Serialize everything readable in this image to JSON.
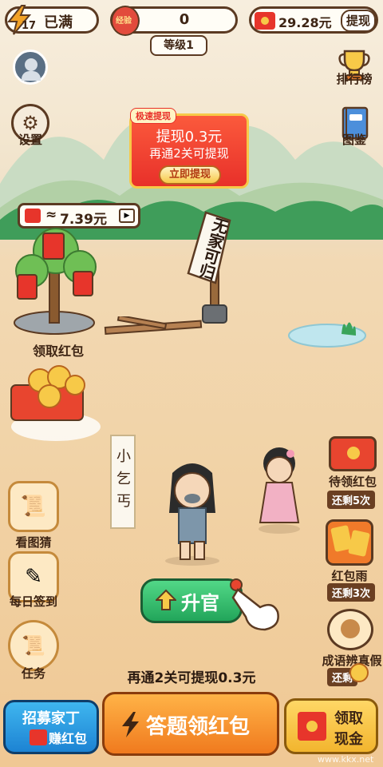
{
  "top_bar": {
    "level_badge": "17",
    "energy_label": "已满",
    "coin_label": "经验",
    "coin_value": "0",
    "level_text": "等级1",
    "balance": "29.28元",
    "withdraw_button": "提现"
  },
  "left_menu": {
    "settings": "设置"
  },
  "right_menu": {
    "ranking": "排行榜",
    "album": "图鉴"
  },
  "promo_card": {
    "tag": "极速提现",
    "title": "提现0.3元",
    "subtitle": "再通2关可提现",
    "button": "立即提现"
  },
  "money_tree": {
    "bubble_approx": "≈",
    "bubble_value": "7.39元",
    "label": "领取红包"
  },
  "signpost": {
    "text": "无家可归"
  },
  "character": {
    "name_scroll": "小乞丐"
  },
  "right_side": {
    "pending_redpacket": "待领红包",
    "pending_remain": "还剩5次",
    "redpacket_rain": "红包雨",
    "rain_remain": "还剩3次",
    "idiom": "成语辨真假",
    "idiom_remain": "还剩"
  },
  "left_side": {
    "guess_picture": "看图猜",
    "daily_signin": "每日签到",
    "tasks": "任务"
  },
  "promote_button": "升官",
  "progress_hint": "再通2关可提现0.3元",
  "bottom": {
    "recruit_line1": "招募家丁",
    "recruit_line2": "赚红包",
    "quiz_button": "答题领红包",
    "cash_line1": "领取",
    "cash_line2": "现金"
  },
  "watermark": "www.kkx.net",
  "colors": {
    "accent_orange": "#f79a2e",
    "accent_green": "#2fbf6a",
    "red_packet": "#e7352b",
    "outline": "#5b3a22"
  }
}
